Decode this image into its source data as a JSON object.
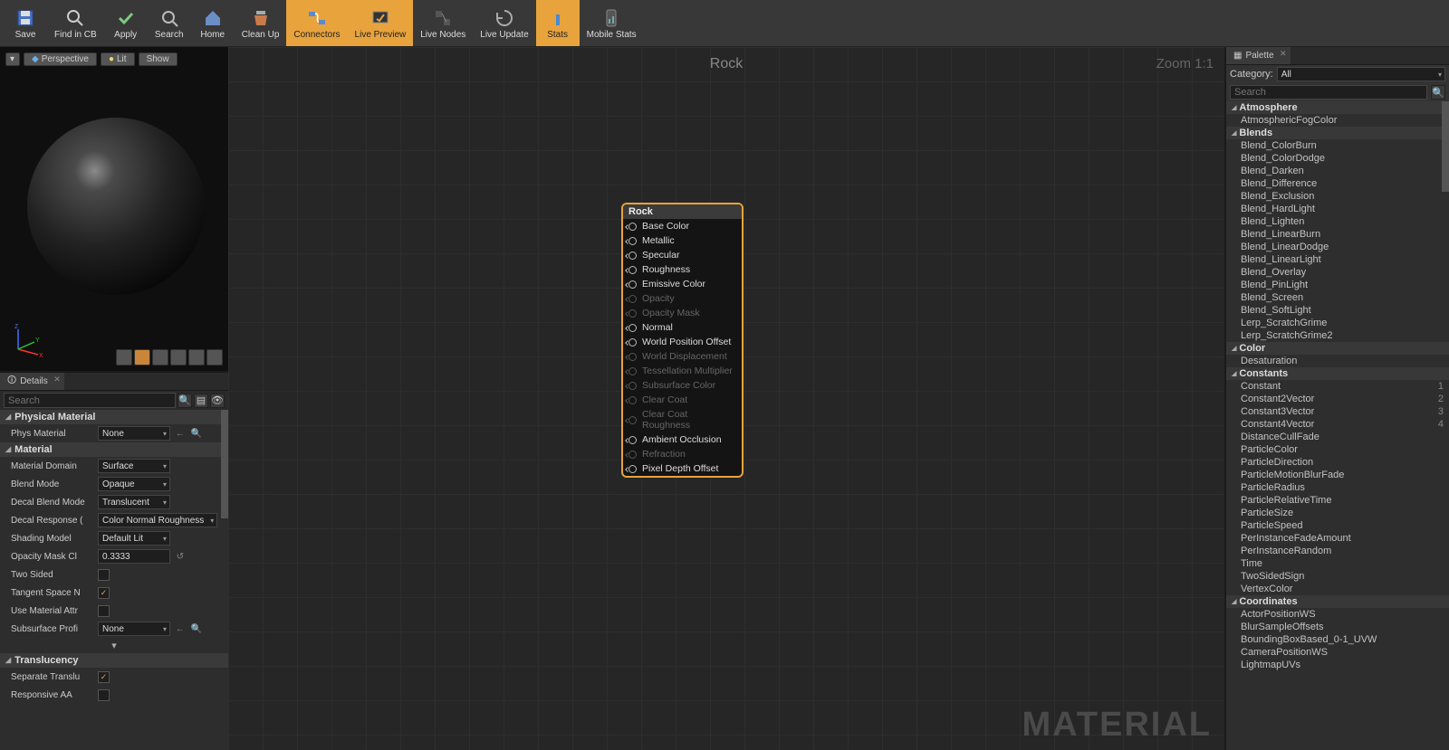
{
  "toolbar": [
    {
      "label": "Save",
      "icon": "save",
      "active": false
    },
    {
      "label": "Find in CB",
      "icon": "find",
      "active": false
    },
    {
      "label": "Apply",
      "icon": "apply",
      "active": false
    },
    {
      "label": "Search",
      "icon": "search",
      "active": false
    },
    {
      "label": "Home",
      "icon": "home",
      "active": false
    },
    {
      "label": "Clean Up",
      "icon": "clean",
      "active": false
    },
    {
      "label": "Connectors",
      "icon": "connectors",
      "active": true
    },
    {
      "label": "Live Preview",
      "icon": "live-preview",
      "active": true
    },
    {
      "label": "Live Nodes",
      "icon": "live-nodes",
      "active": false
    },
    {
      "label": "Live Update",
      "icon": "live-update",
      "active": false
    },
    {
      "label": "Stats",
      "icon": "stats",
      "active": true
    },
    {
      "label": "Mobile Stats",
      "icon": "mobile-stats",
      "active": false
    }
  ],
  "viewport": {
    "view_mode": "Perspective",
    "lit": "Lit",
    "show": "Show"
  },
  "details_tab": "Details",
  "details_search_placeholder": "Search",
  "sections": {
    "physical_material": {
      "title": "Physical Material",
      "phys_material_label": "Phys Material",
      "phys_material_value": "None"
    },
    "material": {
      "title": "Material",
      "rows": {
        "material_domain": {
          "label": "Material Domain",
          "value": "Surface"
        },
        "blend_mode": {
          "label": "Blend Mode",
          "value": "Opaque"
        },
        "decal_blend_mode": {
          "label": "Decal Blend Mode",
          "value": "Translucent"
        },
        "decal_response": {
          "label": "Decal Response (",
          "value": "Color Normal Roughness"
        },
        "shading_model": {
          "label": "Shading Model",
          "value": "Default Lit"
        },
        "opacity_mask": {
          "label": "Opacity Mask Cl",
          "value": "0.3333"
        },
        "two_sided": {
          "label": "Two Sided",
          "checked": false
        },
        "tangent_space": {
          "label": "Tangent Space N",
          "checked": true
        },
        "use_material_attr": {
          "label": "Use Material Attr",
          "checked": false
        },
        "subsurface_profile": {
          "label": "Subsurface Profi",
          "value": "None"
        }
      }
    },
    "translucency": {
      "title": "Translucency",
      "rows": {
        "separate": {
          "label": "Separate Translu",
          "checked": true
        },
        "responsive_aa": {
          "label": "Responsive AA",
          "checked": false
        }
      }
    }
  },
  "graph": {
    "title": "Rock",
    "zoom": "Zoom 1:1",
    "watermark": "MATERIAL",
    "node": {
      "title": "Rock",
      "pins": [
        {
          "label": "Base Color",
          "enabled": true
        },
        {
          "label": "Metallic",
          "enabled": true
        },
        {
          "label": "Specular",
          "enabled": true
        },
        {
          "label": "Roughness",
          "enabled": true
        },
        {
          "label": "Emissive Color",
          "enabled": true
        },
        {
          "label": "Opacity",
          "enabled": false
        },
        {
          "label": "Opacity Mask",
          "enabled": false
        },
        {
          "label": "Normal",
          "enabled": true
        },
        {
          "label": "World Position Offset",
          "enabled": true
        },
        {
          "label": "World Displacement",
          "enabled": false
        },
        {
          "label": "Tessellation Multiplier",
          "enabled": false
        },
        {
          "label": "Subsurface Color",
          "enabled": false
        },
        {
          "label": "Clear Coat",
          "enabled": false
        },
        {
          "label": "Clear Coat Roughness",
          "enabled": false
        },
        {
          "label": "Ambient Occlusion",
          "enabled": true
        },
        {
          "label": "Refraction",
          "enabled": false
        },
        {
          "label": "Pixel Depth Offset",
          "enabled": true
        }
      ]
    }
  },
  "palette": {
    "tab": "Palette",
    "category_label": "Category:",
    "category_value": "All",
    "search_placeholder": "Search",
    "groups": [
      {
        "name": "Atmosphere",
        "items": [
          {
            "n": "AtmosphericFogColor"
          }
        ]
      },
      {
        "name": "Blends",
        "items": [
          {
            "n": "Blend_ColorBurn"
          },
          {
            "n": "Blend_ColorDodge"
          },
          {
            "n": "Blend_Darken"
          },
          {
            "n": "Blend_Difference"
          },
          {
            "n": "Blend_Exclusion"
          },
          {
            "n": "Blend_HardLight"
          },
          {
            "n": "Blend_Lighten"
          },
          {
            "n": "Blend_LinearBurn"
          },
          {
            "n": "Blend_LinearDodge"
          },
          {
            "n": "Blend_LinearLight"
          },
          {
            "n": "Blend_Overlay"
          },
          {
            "n": "Blend_PinLight"
          },
          {
            "n": "Blend_Screen"
          },
          {
            "n": "Blend_SoftLight"
          },
          {
            "n": "Lerp_ScratchGrime"
          },
          {
            "n": "Lerp_ScratchGrime2"
          }
        ]
      },
      {
        "name": "Color",
        "items": [
          {
            "n": "Desaturation"
          }
        ]
      },
      {
        "name": "Constants",
        "items": [
          {
            "n": "Constant",
            "k": "1"
          },
          {
            "n": "Constant2Vector",
            "k": "2"
          },
          {
            "n": "Constant3Vector",
            "k": "3"
          },
          {
            "n": "Constant4Vector",
            "k": "4"
          },
          {
            "n": "DistanceCullFade"
          },
          {
            "n": "ParticleColor"
          },
          {
            "n": "ParticleDirection"
          },
          {
            "n": "ParticleMotionBlurFade"
          },
          {
            "n": "ParticleRadius"
          },
          {
            "n": "ParticleRelativeTime"
          },
          {
            "n": "ParticleSize"
          },
          {
            "n": "ParticleSpeed"
          },
          {
            "n": "PerInstanceFadeAmount"
          },
          {
            "n": "PerInstanceRandom"
          },
          {
            "n": "Time"
          },
          {
            "n": "TwoSidedSign"
          },
          {
            "n": "VertexColor"
          }
        ]
      },
      {
        "name": "Coordinates",
        "items": [
          {
            "n": "ActorPositionWS"
          },
          {
            "n": "BlurSampleOffsets"
          },
          {
            "n": "BoundingBoxBased_0-1_UVW"
          },
          {
            "n": "CameraPositionWS"
          },
          {
            "n": "LightmapUVs"
          }
        ]
      }
    ]
  }
}
